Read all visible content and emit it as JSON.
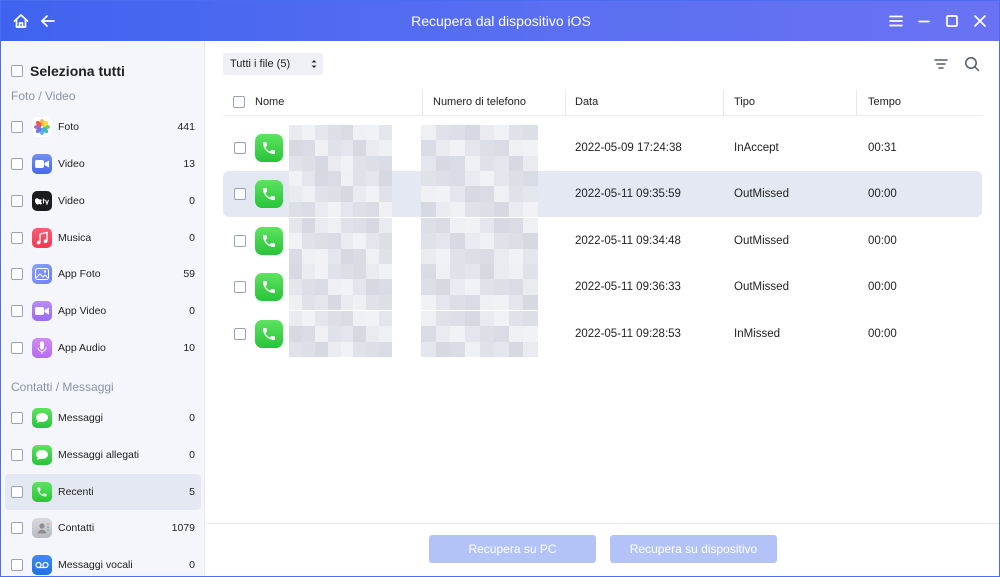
{
  "window": {
    "title": "Recupera dal dispositivo iOS"
  },
  "sidebar": {
    "select_all_label": "Seleziona tutti",
    "sections": [
      {
        "title": "Foto / Video"
      },
      {
        "title": "Contatti / Messaggi"
      }
    ],
    "items": [
      {
        "label": "Foto",
        "count": "441",
        "icon": "photos-icon"
      },
      {
        "label": "Video",
        "count": "13",
        "icon": "video-camera-icon"
      },
      {
        "label": "Video",
        "count": "0",
        "icon": "apple-tv-icon"
      },
      {
        "label": "Musica",
        "count": "0",
        "icon": "music-note-icon"
      },
      {
        "label": "App Foto",
        "count": "59",
        "icon": "app-photos-icon"
      },
      {
        "label": "App Video",
        "count": "0",
        "icon": "app-video-icon"
      },
      {
        "label": "App Audio",
        "count": "10",
        "icon": "microphone-icon"
      },
      {
        "label": "Messaggi",
        "count": "0",
        "icon": "message-bubble-icon"
      },
      {
        "label": "Messaggi allegati",
        "count": "0",
        "icon": "message-attachment-icon"
      },
      {
        "label": "Recenti",
        "count": "5",
        "icon": "phone-icon",
        "active": true
      },
      {
        "label": "Contatti",
        "count": "1079",
        "icon": "contacts-icon"
      },
      {
        "label": "Messaggi vocali",
        "count": "0",
        "icon": "voicemail-icon"
      }
    ]
  },
  "toolbar": {
    "filter_value": "Tutti i file (5)"
  },
  "table": {
    "headers": {
      "name": "Nome",
      "phone": "Numero di telefono",
      "date": "Data",
      "type": "Tipo",
      "time": "Tempo"
    },
    "rows": [
      {
        "date": "2022-05-09 17:24:38",
        "type": "InAccept",
        "time": "00:31"
      },
      {
        "date": "2022-05-11 09:35:59",
        "type": "OutMissed",
        "time": "00:00",
        "selected": true
      },
      {
        "date": "2022-05-11 09:34:48",
        "type": "OutMissed",
        "time": "00:00"
      },
      {
        "date": "2022-05-11 09:36:33",
        "type": "OutMissed",
        "time": "00:00"
      },
      {
        "date": "2022-05-11 09:28:53",
        "type": "InMissed",
        "time": "00:00"
      }
    ]
  },
  "footer": {
    "recover_pc_label": "Recupera su PC",
    "recover_device_label": "Recupera su dispositivo"
  },
  "colors": {
    "titlebar": "#4466f0",
    "accent_button_disabled": "#b3c3f7",
    "selected_row": "#e4e8f3",
    "phone_green": "#34c759"
  }
}
